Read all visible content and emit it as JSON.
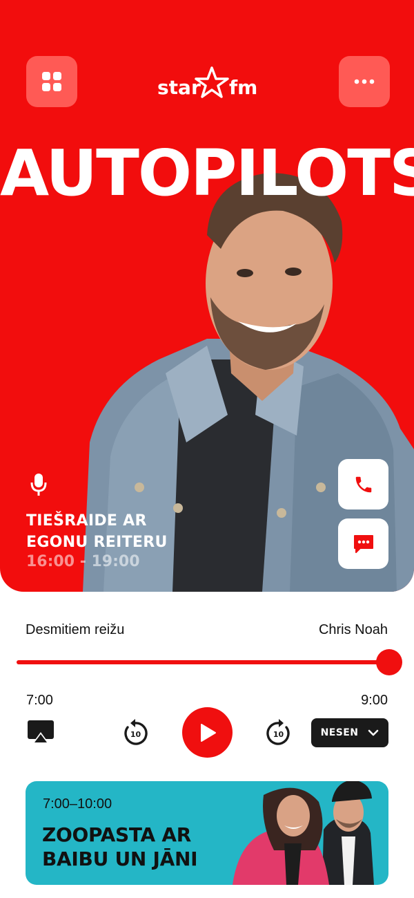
{
  "brand": {
    "name_left": "star",
    "name_right": "fm"
  },
  "header": {
    "menu_icon": "grid-icon",
    "more_icon": "more-dots-icon"
  },
  "show": {
    "title": "AUTOPILOTS"
  },
  "live": {
    "line1": "TIEŠRAIDE AR",
    "line2": "EGONU REITERU",
    "time": "16:00 - 19:00"
  },
  "actions": {
    "call_icon": "phone-icon",
    "chat_icon": "chat-bubble-icon"
  },
  "player": {
    "track_title": "Desmitiem reižu",
    "track_artist": "Chris Noah",
    "progress": 1.0,
    "time_start": "7:00",
    "time_end": "9:00",
    "skip_back": "10",
    "skip_forward": "10",
    "recent_label": "NESEN"
  },
  "promo": {
    "time": "7:00–10:00",
    "title_line1": "ZOOPASTA AR",
    "title_line2": "BAIBU UN JĀNI"
  },
  "colors": {
    "brand_red": "#f20d0d",
    "promo_teal": "#24b6c6",
    "dark": "#1a1a1a"
  }
}
